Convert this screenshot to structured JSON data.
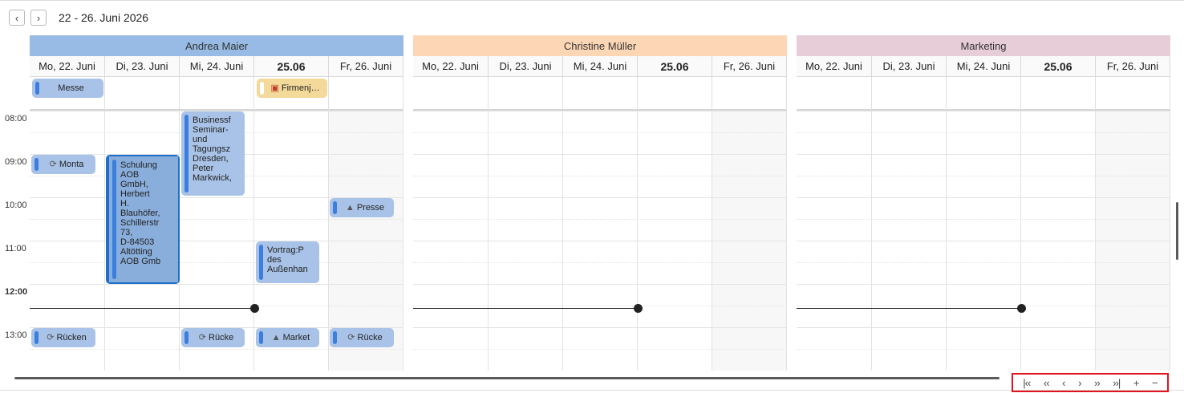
{
  "toolbar": {
    "date_range": "22 - 26. Juni 2026"
  },
  "groups": [
    {
      "name": "Andrea Maier",
      "color": "#97bbe5",
      "days": [
        "Mo, 22. Juni",
        "Di, 23. Juni",
        "Mi, 24. Juni",
        "25.06",
        "Fr, 26. Juni"
      ]
    },
    {
      "name": "Christine Müller",
      "color": "#fdd7b5",
      "days": [
        "Mo, 22. Juni",
        "Di, 23. Juni",
        "Mi, 24. Juni",
        "25.06",
        "Fr, 26. Juni"
      ]
    },
    {
      "name": "Marketing",
      "color": "#e6cdd8",
      "days": [
        "Mo, 22. Juni",
        "Di, 23. Juni",
        "Mi, 24. Juni",
        "25.06",
        "Fr, 26. Juni"
      ]
    }
  ],
  "times": [
    "08:00",
    "09:00",
    "10:00",
    "11:00",
    "12:00",
    "13:00"
  ],
  "events": {
    "allday_messe": "Messe",
    "allday_firmen": "Firmenj…",
    "monta": "Monta",
    "schulung": "Schulung\nAOB\nGmbH,\nHerbert\nH.\nBlauhöfer,\nSchillerstr\n73,\nD-84503\nAltötting\nAOB Gmb",
    "business": "Businessf\nSeminar-\nund\nTagungsz\nDresden,\nPeter\nMarkwick,",
    "presse": "Presse",
    "vortrag": "Vortrag:P\ndes\nAußenhan",
    "ruecken": "Rücken",
    "ruecke_mi": "Rücke",
    "market": "Market",
    "ruecke_fr": "Rücke"
  },
  "icons": {
    "prev": "chevron-left-icon",
    "next": "chevron-right-icon",
    "recurring": "refresh-icon",
    "reminder": "bell-icon",
    "briefcase": "briefcase-icon"
  },
  "pager": [
    "first-page-icon",
    "fast-back-icon",
    "prev-icon",
    "next-icon",
    "fast-forward-icon",
    "last-page-icon",
    "zoom-in-icon",
    "zoom-out-icon"
  ]
}
